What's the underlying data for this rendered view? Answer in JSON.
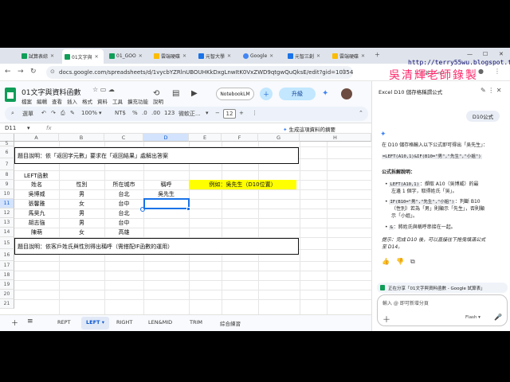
{
  "browser": {
    "tabs": [
      {
        "label": "試算表綜",
        "color": "#0f9d58"
      },
      {
        "label": "01文字與",
        "color": "#0f9d58",
        "active": true
      },
      {
        "label": "01_GOO",
        "color": "#0f9d58"
      },
      {
        "label": "雲端硬碟",
        "color": "#fbbc04"
      },
      {
        "label": "元智大學",
        "color": "#1a73e8"
      },
      {
        "label": "Google",
        "color": "#4285f4"
      },
      {
        "label": "元智三創",
        "color": "#1a73e8"
      },
      {
        "label": "雲端硬碟",
        "color": "#fbbc04"
      }
    ],
    "url": "docs.google.com/spreadsheets/d/1vycbYZRlnUBOUHKkDxgLnwItK0VxZWD9qtgwQuQksE/edit?gid=103541...",
    "gemini_label": "開啟 Gemini"
  },
  "watermark": {
    "url": "http://terry55wu.blogspot.tw",
    "name": "吳清輝老師錄製"
  },
  "doc": {
    "title": "01文字與資料函數",
    "menus": [
      "檔案",
      "編輯",
      "查看",
      "插入",
      "格式",
      "資料",
      "工具",
      "擴充功能",
      "說明"
    ],
    "notebooklm": "NotebookLM",
    "upgrade": "升級"
  },
  "toolbar": {
    "search": "選單",
    "zoom": "100%",
    "currency": "NT$",
    "percent": "%",
    "decimals": "123",
    "font": "微軟正...",
    "font_size": "12"
  },
  "formula": {
    "namebox": "D11",
    "fx": "fx",
    "summarize": "生成這項資料的摘要"
  },
  "grid": {
    "columns": [
      "A",
      "B",
      "C",
      "D",
      "E",
      "F",
      "G",
      "H"
    ],
    "rows": [
      "5",
      "6",
      "7",
      "8",
      "9",
      "10",
      "11",
      "12",
      "13",
      "14",
      "15",
      "16",
      "17",
      "18",
      "19",
      "20",
      "21"
    ],
    "box1": "題目說明：依「返回字元數」要求在「返回結果」處解出答案",
    "section_title": "LEFT函數",
    "headers": [
      "姓名",
      "性別",
      "所在城市",
      "稱呼"
    ],
    "example": "例如：吳先生（D10位置）",
    "records": [
      {
        "name": "吳博威",
        "gender": "男",
        "city": "台北",
        "title": "吳先生"
      },
      {
        "name": "張馨雅",
        "gender": "女",
        "city": "台中",
        "title": ""
      },
      {
        "name": "馬昊九",
        "gender": "男",
        "city": "台北",
        "title": ""
      },
      {
        "name": "胡志強",
        "gender": "男",
        "city": "台中",
        "title": ""
      },
      {
        "name": "陳萌",
        "gender": "女",
        "city": "高雄",
        "title": ""
      }
    ],
    "box2": "題目說明：依客戶姓氏與性別得出稱呼（需搭配IF函數的運用）"
  },
  "sheet_tabs": [
    "REPT",
    "LEFT",
    "RIGHT",
    "LEN&MID",
    "TRIM",
    "綜合練習"
  ],
  "gemini": {
    "title": "Excel D10 儲存格稱謂公式",
    "user_msg": "D10公式",
    "intro": "在 D10 儲存格輸入以下公式即可得出「吳先生」：",
    "formula": "=LEFT(A10,1)&IF(B10=\"男\",\"先生\",\"小姐\")",
    "breakdown_title": "公式拆解說明：",
    "b1_code": "LEFT(A10,1)",
    "b1_text_a": "：擷取 A10（吳博威）的最",
    "b1_text_b": "左邊 1 個字，取得姓氏「吳」。",
    "b2_code": "IF(B10=\"男\",\"先生\",\"小姐\")",
    "b2_text_a": "：判斷 B10",
    "b2_text_b": "（性別）若為「男」則顯示「先生」，否則顯",
    "b2_text_c": "示「小姐」。",
    "b3_code": "&",
    "b3_text": "：將姓氏與稱呼串接在一起。",
    "tip_a": "提示：完成 D10 後，可以直接往下拖曳填滿公式",
    "tip_b": "至 D14。",
    "share": "正在分享「01文字與資料函數 - Google 試算表」",
    "placeholder": "輸入 @ 即可新增分頁",
    "model": "Flash"
  }
}
